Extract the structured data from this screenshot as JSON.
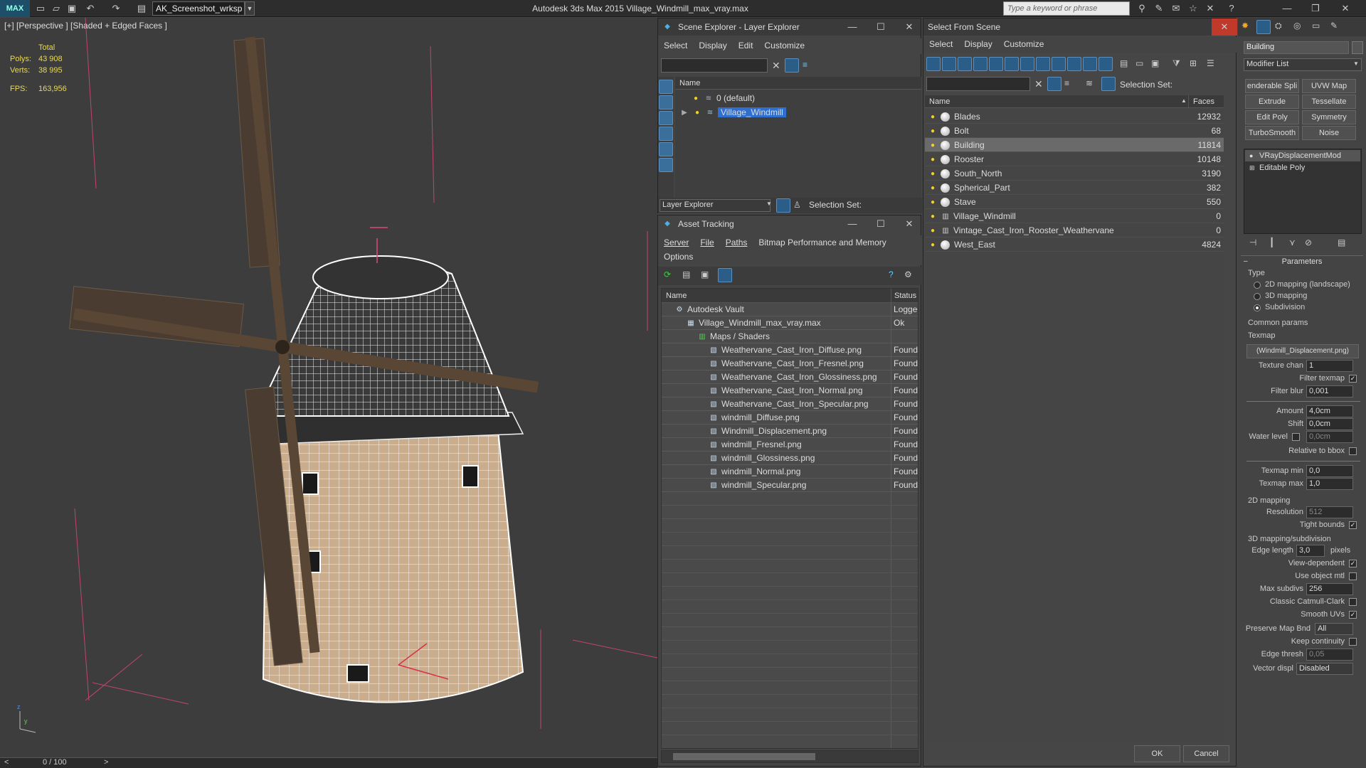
{
  "titlebar": {
    "logo": "MAX",
    "workspace": "AK_Screenshot_wrksp",
    "app_title": "Autodesk 3ds Max  2015     Village_Windmill_max_vray.max",
    "search_placeholder": "Type a keyword or phrase"
  },
  "viewport": {
    "label": "[+] [Perspective ] [Shaded + Edged Faces ]",
    "stats": {
      "total": "Total",
      "polys_label": "Polys:",
      "polys": "43 908",
      "verts_label": "Verts:",
      "verts": "38 995",
      "fps_label": "FPS:",
      "fps": "163,956"
    },
    "timeline": "0 / 100",
    "tl_prev": "<",
    "tl_next": ">"
  },
  "layer_explorer": {
    "title": "Scene Explorer - Layer Explorer",
    "menu": [
      "Select",
      "Display",
      "Edit",
      "Customize"
    ],
    "col_name": "Name",
    "layers": [
      "0 (default)",
      "Village_Windmill"
    ],
    "footer_label": "Layer Explorer",
    "selection_set": "Selection Set:"
  },
  "asset_tracking": {
    "title": "Asset Tracking",
    "menu": [
      "Server",
      "File",
      "Paths",
      "Bitmap Performance and Memory"
    ],
    "menu2": "Options",
    "col_name": "Name",
    "col_status": "Status",
    "rows": [
      {
        "name": "Autodesk Vault",
        "status": "Logged",
        "indent": 0
      },
      {
        "name": "Village_Windmill_max_vray.max",
        "status": "Ok",
        "indent": 1
      },
      {
        "name": "Maps / Shaders",
        "status": "",
        "indent": 2
      },
      {
        "name": "Weathervane_Cast_Iron_Diffuse.png",
        "status": "Found",
        "indent": 3
      },
      {
        "name": "Weathervane_Cast_Iron_Fresnel.png",
        "status": "Found",
        "indent": 3
      },
      {
        "name": "Weathervane_Cast_Iron_Glossiness.png",
        "status": "Found",
        "indent": 3
      },
      {
        "name": "Weathervane_Cast_Iron_Normal.png",
        "status": "Found",
        "indent": 3
      },
      {
        "name": "Weathervane_Cast_Iron_Specular.png",
        "status": "Found",
        "indent": 3
      },
      {
        "name": "windmill_Diffuse.png",
        "status": "Found",
        "indent": 3
      },
      {
        "name": "Windmill_Displacement.png",
        "status": "Found",
        "indent": 3
      },
      {
        "name": "windmill_Fresnel.png",
        "status": "Found",
        "indent": 3
      },
      {
        "name": "windmill_Glossiness.png",
        "status": "Found",
        "indent": 3
      },
      {
        "name": "windmill_Normal.png",
        "status": "Found",
        "indent": 3
      },
      {
        "name": "windmill_Specular.png",
        "status": "Found",
        "indent": 3
      }
    ]
  },
  "select_from_scene": {
    "title": "Select From Scene",
    "menu": [
      "Select",
      "Display",
      "Customize"
    ],
    "selection_set": "Selection Set:",
    "col_name": "Name",
    "col_faces": "Faces",
    "rows": [
      {
        "name": "Blades",
        "faces": "12932"
      },
      {
        "name": "Bolt",
        "faces": "68"
      },
      {
        "name": "Building",
        "faces": "11814"
      },
      {
        "name": "Rooster",
        "faces": "10148"
      },
      {
        "name": "South_North",
        "faces": "3190"
      },
      {
        "name": "Spherical_Part",
        "faces": "382"
      },
      {
        "name": "Stave",
        "faces": "550"
      },
      {
        "name": "Village_Windmill",
        "faces": "0"
      },
      {
        "name": "Vintage_Cast_Iron_Rooster_Weathervane",
        "faces": "0"
      },
      {
        "name": "West_East",
        "faces": "4824"
      }
    ],
    "ok": "OK",
    "cancel": "Cancel"
  },
  "command_panel": {
    "object_name": "Building",
    "modifier_list": "Modifier List",
    "buttons": [
      "enderable Spli",
      "UVW Map",
      "Extrude",
      "Tessellate",
      "Edit Poly",
      "Symmetry",
      "TurboSmooth",
      "Noise"
    ],
    "stack": [
      "VRayDisplacementMod",
      "Editable Poly"
    ],
    "params_title": "Parameters",
    "type_label": "Type",
    "types": [
      "2D mapping (landscape)",
      "3D mapping",
      "Subdivision"
    ],
    "common_params": "Common params",
    "texmap_label": "Texmap",
    "texmap": "(Windmill_Displacement.png)",
    "texture_chan_label": "Texture chan",
    "texture_chan": "1",
    "filter_texmap": "Filter texmap",
    "filter_blur_label": "Filter blur",
    "filter_blur": "0,001",
    "amount_label": "Amount",
    "amount": "4,0cm",
    "shift_label": "Shift",
    "shift": "0,0cm",
    "water_label": "Water level",
    "water": "0,0cm",
    "relative": "Relative to bbox",
    "texmin_label": "Texmap min",
    "texmin": "0,0",
    "texmax_label": "Texmap max",
    "texmax": "1,0",
    "map2d": "2D mapping",
    "resolution_label": "Resolution",
    "resolution": "512",
    "tight": "Tight bounds",
    "map3d": "3D mapping/subdivision",
    "edge_len_label": "Edge length",
    "edge_len": "3,0",
    "pixels": "pixels",
    "view_dep": "View-dependent",
    "use_obj": "Use object mtl",
    "max_subdivs_label": "Max subdivs",
    "max_subdivs": "256",
    "catmull": "Classic Catmull-Clark",
    "smooth_uvs": "Smooth UVs",
    "preserve_label": "Preserve Map Bnd",
    "preserve": "All",
    "keep": "Keep continuity",
    "edge_thresh_label": "Edge thresh",
    "edge_thresh": "0,05",
    "vector_label": "Vector displ",
    "vector": "Disabled"
  }
}
